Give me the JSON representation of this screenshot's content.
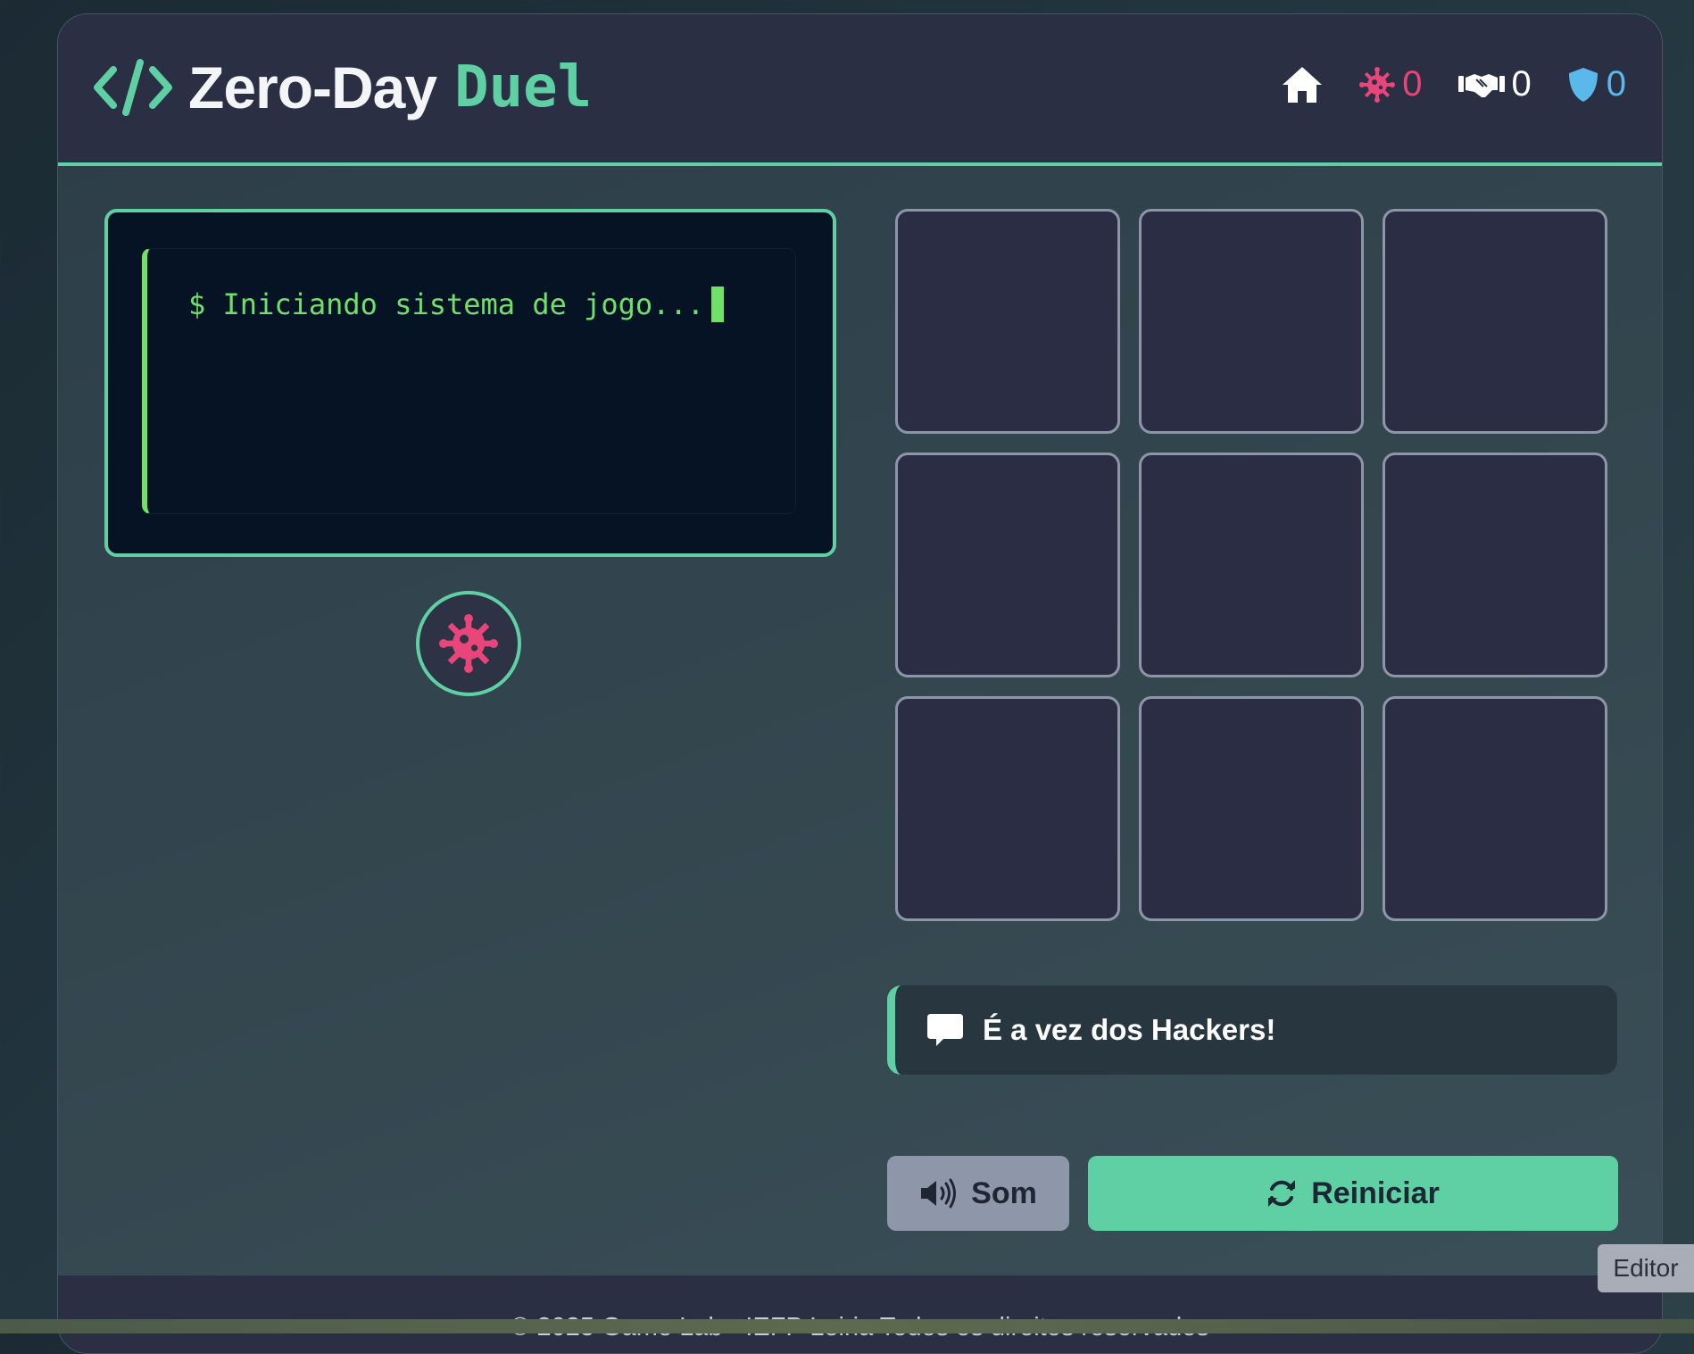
{
  "header": {
    "title_part1": "Zero-Day",
    "title_part2": "Duel"
  },
  "scores": {
    "hackers": "0",
    "draws": "0",
    "defenders": "0"
  },
  "terminal": {
    "line": "$ Iniciando sistema de jogo..."
  },
  "board": {
    "cells": [
      "",
      "",
      "",
      "",
      "",
      "",
      "",
      "",
      ""
    ]
  },
  "status": {
    "message": "É a vez dos Hackers!"
  },
  "controls": {
    "sound_label": "Som",
    "restart_label": "Reiniciar"
  },
  "footer": {
    "text": "©  2025  Game Lab - IEFP Leiria  Todos os direitos reservados"
  },
  "editor_tag": "Editor",
  "icons": {
    "logo": "code-icon",
    "home": "home-icon",
    "hackers": "virus-icon",
    "draws": "handshake-icon",
    "defenders": "shield-icon",
    "current_player": "virus-icon",
    "status": "comment-icon",
    "sound": "volume-icon",
    "restart": "refresh-icon"
  },
  "colors": {
    "accent": "#5ed0a4",
    "hackers": "#e8457a",
    "defenders": "#5ab8ea",
    "terminal_text": "#6fe06a",
    "header_bg": "#2b2f44"
  }
}
